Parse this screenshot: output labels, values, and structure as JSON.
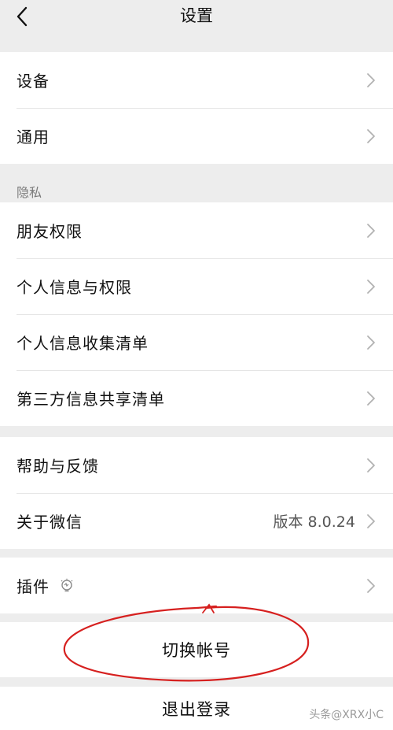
{
  "nav": {
    "title": "设置"
  },
  "groups": {
    "g1": [
      {
        "label": "设备"
      },
      {
        "label": "通用"
      }
    ],
    "privacy_header": "隐私",
    "g2": [
      {
        "label": "朋友权限"
      },
      {
        "label": "个人信息与权限"
      },
      {
        "label": "个人信息收集清单"
      },
      {
        "label": "第三方信息共享清单"
      }
    ],
    "g3": [
      {
        "label": "帮助与反馈"
      },
      {
        "label": "关于微信",
        "value": "版本 8.0.24"
      }
    ],
    "g4": [
      {
        "label": "插件"
      }
    ]
  },
  "buttons": {
    "switch_account": "切换帐号",
    "logout": "退出登录"
  },
  "watermark": "头条@XRX小C",
  "colors": {
    "background": "#ededed",
    "card": "#ffffff",
    "annotation": "#d6201f"
  }
}
